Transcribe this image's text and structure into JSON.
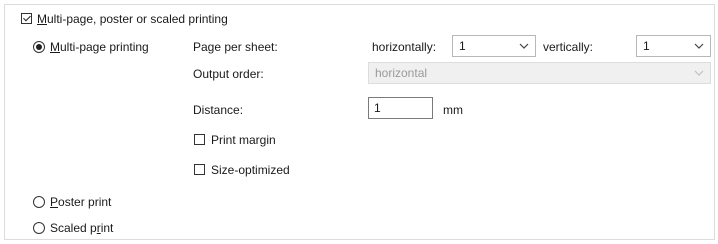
{
  "main_checkbox": {
    "pre": "",
    "mnemonic": "M",
    "post": "ulti-page, poster or scaled printing",
    "checked": true
  },
  "modes": [
    {
      "pre": "",
      "mnemonic": "M",
      "post": "ulti-page printing",
      "selected": true
    },
    {
      "pre": "",
      "mnemonic": "P",
      "post": "oster print",
      "selected": false
    },
    {
      "pre": "Scaled p",
      "mnemonic": "r",
      "post": "int",
      "selected": false
    }
  ],
  "multipage": {
    "page_per_sheet_label": "Page per sheet:",
    "horizontally_label": "horizontally:",
    "horizontally_value": "1",
    "vertically_label": "vertically:",
    "vertically_value": "1",
    "output_order_label": "Output order:",
    "output_order_value": "horizontal",
    "output_order_enabled": false,
    "distance_label": "Distance:",
    "distance_value": "1",
    "distance_unit": "mm",
    "print_margin_label": "Print margin",
    "print_margin_checked": false,
    "size_optimized_label": "Size-optimized",
    "size_optimized_checked": false
  },
  "icons": {
    "dropdown": "chevron-down-icon"
  }
}
